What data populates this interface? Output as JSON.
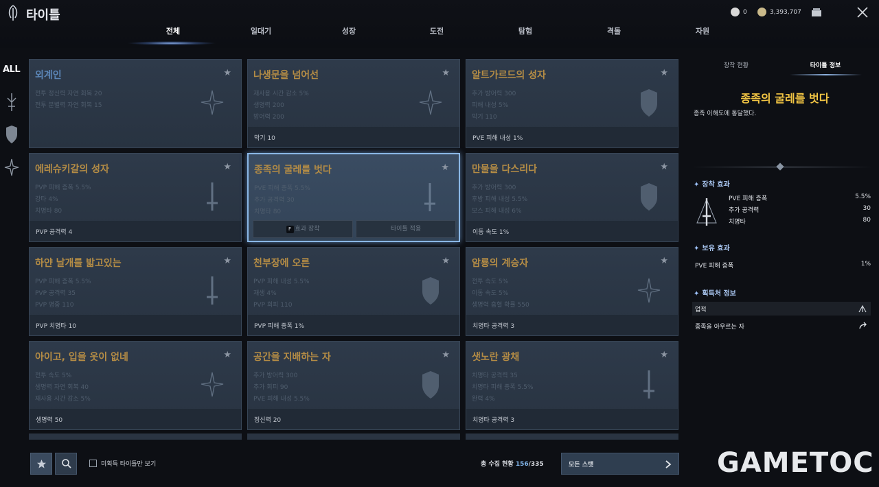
{
  "header": {
    "title": "타이틀",
    "currency1_value": "0",
    "currency2_value": "3,393,707",
    "tabs": [
      "전체",
      "일대기",
      "성장",
      "도전",
      "탐험",
      "격돌",
      "자원"
    ],
    "active_tab": "전체"
  },
  "filter": {
    "all_label": "ALL"
  },
  "cards": [
    {
      "title": "외계인",
      "stats": [
        "전투 정신력 자연 회복 20",
        "전투 분별력 자연 회복 15"
      ],
      "bonus": "",
      "title_color": "blue"
    },
    {
      "title": "나생문을 넘어선",
      "stats": [
        "재사용 시간 감소 5%",
        "생명력 200",
        "방어력 200"
      ],
      "bonus": "막기 10"
    },
    {
      "title": "알트가르드의 성자",
      "stats": [
        "추가 방어력 300",
        "피해 내성 5%",
        "막기 110"
      ],
      "bonus": "PVE 피해 내성 1%"
    },
    {
      "title": "에레슈키갈의 성자",
      "stats": [
        "PVP 피해 증폭 5.5%",
        "강타 4%",
        "치명타 80"
      ],
      "bonus": "PVP 공격력 4"
    },
    {
      "title": "종족의 굴레를 벗다",
      "stats": [
        "PVE 피해 증폭 5.5%",
        "추가 공격력 30",
        "치명타 80"
      ],
      "bonus": ""
    },
    {
      "title": "만물을 다스리다",
      "stats": [
        "추가 방어력 300",
        "후방 피해 내성 5.5%",
        "보스 피해 내성 6%"
      ],
      "bonus": "이동 속도 1%"
    },
    {
      "title": "하얀 날개를 밟고있는",
      "stats": [
        "PVP 피해 증폭 5.5%",
        "PVP 공격력 35",
        "PVP 명중 110"
      ],
      "bonus": "PVP 치명타 10"
    },
    {
      "title": "천부장에 오른",
      "stats": [
        "PVP 피해 내성 5.5%",
        "재생 4%",
        "PVP 회피 110"
      ],
      "bonus": "PVP 피해 증폭 1%"
    },
    {
      "title": "암룡의 계승자",
      "stats": [
        "전투 속도 5%",
        "이동 속도 5%",
        "생명력 흡혈 확률 550"
      ],
      "bonus": "치명타 공격력 3"
    },
    {
      "title": "아이고, 입을 옷이 없네",
      "stats": [
        "전투 속도 5%",
        "생명력 자연 회복 40",
        "재사용 시간 감소 5%"
      ],
      "bonus": "생명력 50"
    },
    {
      "title": "공간을 지배하는 자",
      "stats": [
        "추가 방어력 300",
        "추가 회피 90",
        "PVE 피해 내성 5.5%"
      ],
      "bonus": "정신력 20"
    },
    {
      "title": "샛노란 광채",
      "stats": [
        "치명타 공격력 35",
        "치명타 피해 증폭 5.5%",
        "완력 4%"
      ],
      "bonus": "치명타 공격력 3"
    }
  ],
  "selected_card": {
    "key_hint": "F",
    "equip_label": "효과 장착",
    "apply_label": "타이틀 적용"
  },
  "bottom": {
    "checkbox_label": "미획득 타이틀만 보기",
    "total_label": "총 수집 현황",
    "total_current": "156",
    "total_max": "/335",
    "all_stats_label": "모든 스탯"
  },
  "right_panel": {
    "tabs": [
      "장착 현황",
      "타이틀 정보"
    ],
    "active_tab": "타이틀 정보",
    "title": "종족의 굴레를 벗다",
    "description": "종족 이해도에 통달했다.",
    "equip_section": "장착 효과",
    "equip_stats": [
      {
        "label": "PVE 피해 증폭",
        "value": "5.5%"
      },
      {
        "label": "추가 공격력",
        "value": "30"
      },
      {
        "label": "치명타",
        "value": "80"
      }
    ],
    "own_section": "보유 효과",
    "own_stat": {
      "label": "PVE 피해 증폭",
      "value": "1%"
    },
    "source_section": "획득처 정보",
    "source_category": "업적",
    "source_name": "종족을 아우르는 자"
  },
  "watermark": "GAMETOC",
  "colors": {
    "accent_gold": "#f2c544",
    "card_title_gold": "#b48c45",
    "selected_border": "#8ab7e6",
    "count_blue": "#7fb2e6"
  }
}
